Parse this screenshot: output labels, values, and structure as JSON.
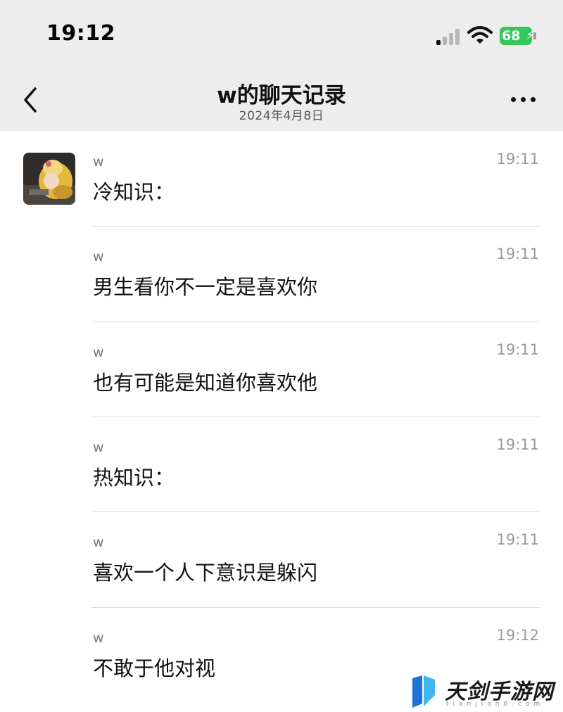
{
  "status_bar": {
    "time": "19:12",
    "battery": "68"
  },
  "nav": {
    "title": "w的聊天记录",
    "subtitle": "2024年4月8日",
    "back_icon": "chevron-left-icon",
    "more_icon": "more-horizontal-icon"
  },
  "messages": [
    {
      "sender": "w",
      "time": "19:11",
      "text": "冷知识："
    },
    {
      "sender": "w",
      "time": "19:11",
      "text": "男生看你不一定是喜欢你"
    },
    {
      "sender": "w",
      "time": "19:11",
      "text": "也有可能是知道你喜欢他"
    },
    {
      "sender": "w",
      "time": "19:11",
      "text": "热知识："
    },
    {
      "sender": "w",
      "time": "19:11",
      "text": "喜欢一个人下意识是躲闪"
    },
    {
      "sender": "w",
      "time": "19:12",
      "text": "不敢于他对视"
    }
  ],
  "watermark": {
    "title": "天剑手游网",
    "url": "tianjian8.com"
  },
  "colors": {
    "header_bg": "#ededed",
    "battery_green": "#34c759"
  }
}
